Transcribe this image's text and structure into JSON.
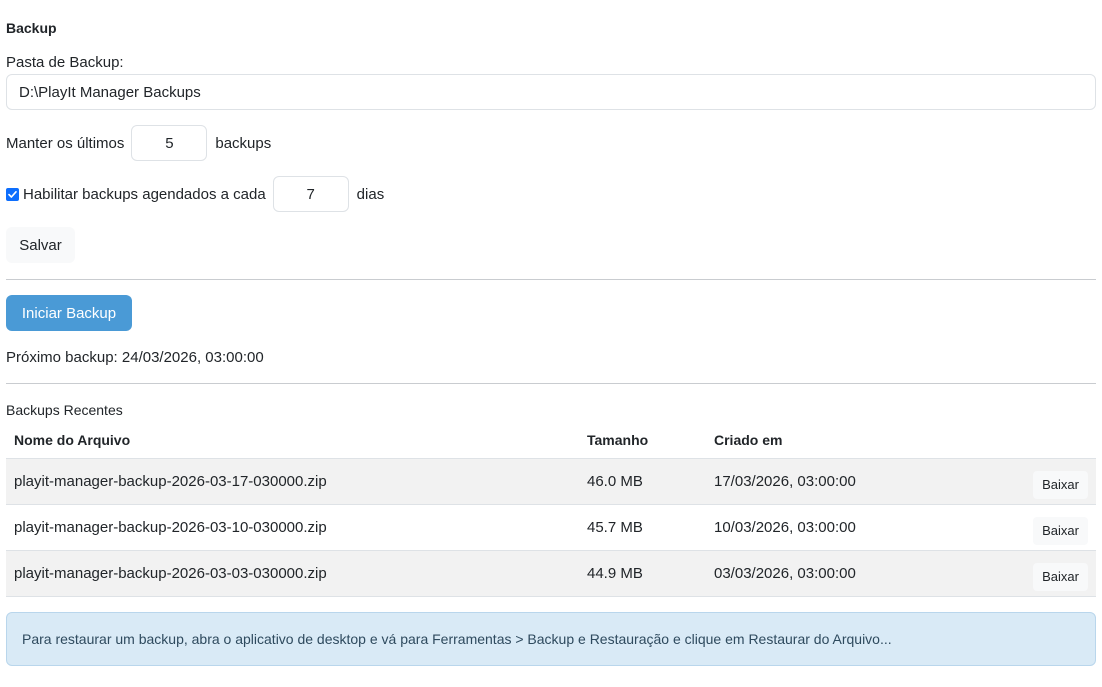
{
  "backup": {
    "section_title": "Backup",
    "folder_label": "Pasta de Backup:",
    "folder_value": "D:\\PlayIt Manager Backups",
    "keep_prefix": "Manter os últimos",
    "keep_value": "5",
    "keep_suffix": "backups",
    "schedule_enabled": true,
    "schedule_prefix": "Habilitar backups agendados a cada",
    "schedule_value": "7",
    "schedule_suffix": "dias",
    "save_label": "Salvar"
  },
  "actions": {
    "start_backup_label": "Iniciar Backup",
    "next_backup_text": "Próximo backup: 24/03/2026, 03:00:00"
  },
  "recent": {
    "title": "Backups Recentes",
    "columns": {
      "name": "Nome do Arquivo",
      "size": "Tamanho",
      "created": "Criado em"
    },
    "rows": [
      {
        "name": "playit-manager-backup-2026-03-17-030000.zip",
        "size": "46.0 MB",
        "created": "17/03/2026, 03:00:00",
        "action": "Baixar"
      },
      {
        "name": "playit-manager-backup-2026-03-10-030000.zip",
        "size": "45.7 MB",
        "created": "10/03/2026, 03:00:00",
        "action": "Baixar"
      },
      {
        "name": "playit-manager-backup-2026-03-03-030000.zip",
        "size": "44.9 MB",
        "created": "03/03/2026, 03:00:00",
        "action": "Baixar"
      }
    ]
  },
  "info": {
    "text": "Para restaurar um backup, abra o aplicativo de desktop e vá para Ferramentas > Backup e Restauração e clique em Restaurar do Arquivo..."
  },
  "colors": {
    "primary_button": "#4a9ad6",
    "checkbox": "#0d6efd",
    "info_background": "#d9eaf6",
    "row_stripe": "#f2f2f2"
  }
}
